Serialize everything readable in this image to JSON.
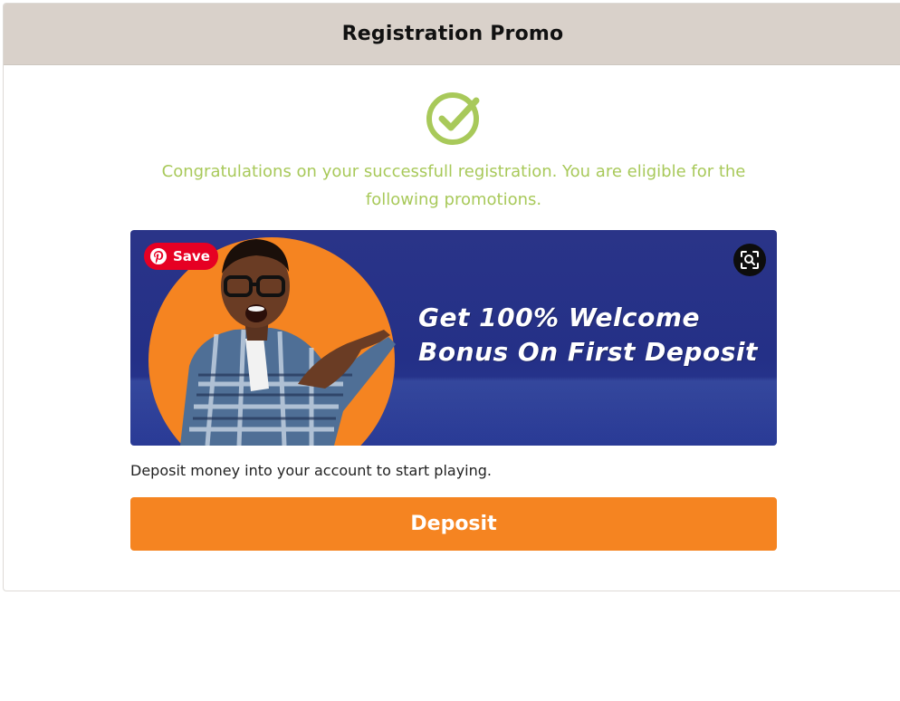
{
  "header": {
    "title": "Registration Promo"
  },
  "status": {
    "icon": "check-circle-icon",
    "message": "Congratulations on your successfull registration. You are eligible for the following promotions."
  },
  "promo_banner": {
    "headline_line1": "Get 100% Welcome",
    "headline_line2": "Bonus On First Deposit",
    "save_label": "Save",
    "save_icon": "pinterest-icon",
    "lens_icon": "visual-search-icon"
  },
  "deposit": {
    "note": "Deposit money into your account to start playing.",
    "button_label": "Deposit"
  },
  "colors": {
    "header_bg": "#d9d1ca",
    "accent_green": "#a8c95a",
    "accent_orange": "#f58421",
    "banner_blue": "#2a3488",
    "pinterest_red": "#e60023"
  }
}
